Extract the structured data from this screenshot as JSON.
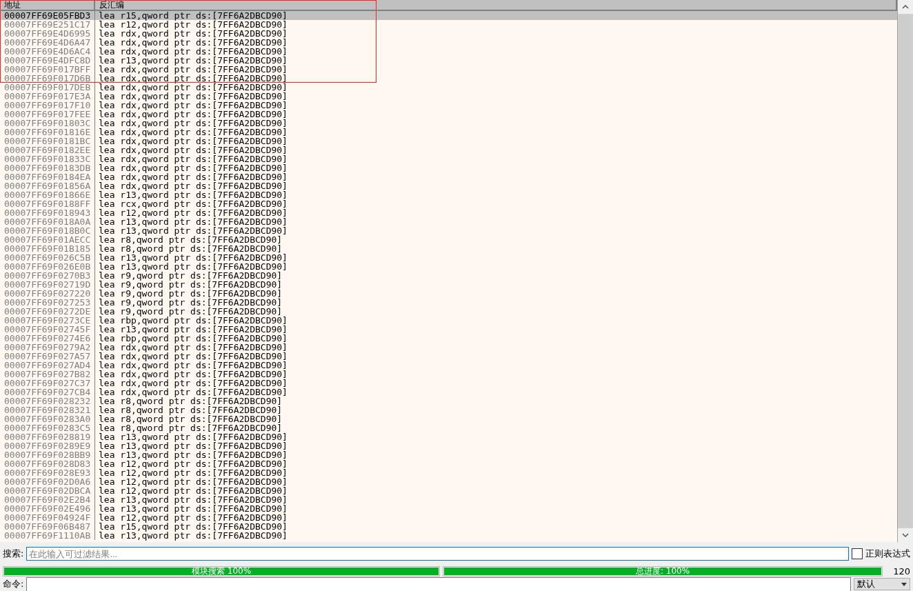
{
  "table": {
    "columns": [
      "地址",
      "反汇编"
    ],
    "rows": [
      {
        "address": "00007FF69E05FBD3",
        "disassembly": "lea r15,qword ptr ds:[7FF6A2DBCD90]",
        "selected": true,
        "boxed": true
      },
      {
        "address": "00007FF69E251C17",
        "disassembly": "lea r12,qword ptr ds:[7FF6A2DBCD90]",
        "selected": false,
        "boxed": true
      },
      {
        "address": "00007FF69E4D6995",
        "disassembly": "lea rdx,qword ptr ds:[7FF6A2DBCD90]",
        "selected": false,
        "boxed": true
      },
      {
        "address": "00007FF69E4D6A47",
        "disassembly": "lea rdx,qword ptr ds:[7FF6A2DBCD90]",
        "selected": false,
        "boxed": true
      },
      {
        "address": "00007FF69E4D6AC4",
        "disassembly": "lea rdx,qword ptr ds:[7FF6A2DBCD90]",
        "selected": false,
        "boxed": true
      },
      {
        "address": "00007FF69E4DFC8D",
        "disassembly": "lea r13,qword ptr ds:[7FF6A2DBCD90]",
        "selected": false,
        "boxed": true
      },
      {
        "address": "00007FF69F017BFF",
        "disassembly": "lea rdx,qword ptr ds:[7FF6A2DBCD90]",
        "selected": false,
        "boxed": true
      },
      {
        "address": "00007FF69F017D6B",
        "disassembly": "lea rdx,qword ptr ds:[7FF6A2DBCD90]",
        "selected": false,
        "boxed": true
      },
      {
        "address": "00007FF69F017DEB",
        "disassembly": "lea rdx,qword ptr ds:[7FF6A2DBCD90]",
        "selected": false,
        "boxed": false
      },
      {
        "address": "00007FF69F017E3A",
        "disassembly": "lea rdx,qword ptr ds:[7FF6A2DBCD90]",
        "selected": false,
        "boxed": false
      },
      {
        "address": "00007FF69F017F10",
        "disassembly": "lea rdx,qword ptr ds:[7FF6A2DBCD90]",
        "selected": false,
        "boxed": false
      },
      {
        "address": "00007FF69F017FEE",
        "disassembly": "lea rdx,qword ptr ds:[7FF6A2DBCD90]",
        "selected": false,
        "boxed": false
      },
      {
        "address": "00007FF69F01803C",
        "disassembly": "lea rdx,qword ptr ds:[7FF6A2DBCD90]",
        "selected": false,
        "boxed": false
      },
      {
        "address": "00007FF69F01816E",
        "disassembly": "lea rdx,qword ptr ds:[7FF6A2DBCD90]",
        "selected": false,
        "boxed": false
      },
      {
        "address": "00007FF69F0181BC",
        "disassembly": "lea rdx,qword ptr ds:[7FF6A2DBCD90]",
        "selected": false,
        "boxed": false
      },
      {
        "address": "00007FF69F0182EE",
        "disassembly": "lea rdx,qword ptr ds:[7FF6A2DBCD90]",
        "selected": false,
        "boxed": false
      },
      {
        "address": "00007FF69F01833C",
        "disassembly": "lea rdx,qword ptr ds:[7FF6A2DBCD90]",
        "selected": false,
        "boxed": false
      },
      {
        "address": "00007FF69F0183DB",
        "disassembly": "lea rdx,qword ptr ds:[7FF6A2DBCD90]",
        "selected": false,
        "boxed": false
      },
      {
        "address": "00007FF69F0184EA",
        "disassembly": "lea rdx,qword ptr ds:[7FF6A2DBCD90]",
        "selected": false,
        "boxed": false
      },
      {
        "address": "00007FF69F01856A",
        "disassembly": "lea rdx,qword ptr ds:[7FF6A2DBCD90]",
        "selected": false,
        "boxed": false
      },
      {
        "address": "00007FF69F01866E",
        "disassembly": "lea r13,qword ptr ds:[7FF6A2DBCD90]",
        "selected": false,
        "boxed": false
      },
      {
        "address": "00007FF69F0188FF",
        "disassembly": "lea rcx,qword ptr ds:[7FF6A2DBCD90]",
        "selected": false,
        "boxed": false
      },
      {
        "address": "00007FF69F018943",
        "disassembly": "lea r12,qword ptr ds:[7FF6A2DBCD90]",
        "selected": false,
        "boxed": false
      },
      {
        "address": "00007FF69F018A0A",
        "disassembly": "lea r13,qword ptr ds:[7FF6A2DBCD90]",
        "selected": false,
        "boxed": false
      },
      {
        "address": "00007FF69F018B0C",
        "disassembly": "lea r13,qword ptr ds:[7FF6A2DBCD90]",
        "selected": false,
        "boxed": false
      },
      {
        "address": "00007FF69F01AECC",
        "disassembly": "lea r8,qword ptr ds:[7FF6A2DBCD90]",
        "selected": false,
        "boxed": false
      },
      {
        "address": "00007FF69F01B185",
        "disassembly": "lea r8,qword ptr ds:[7FF6A2DBCD90]",
        "selected": false,
        "boxed": false
      },
      {
        "address": "00007FF69F026C5B",
        "disassembly": "lea r13,qword ptr ds:[7FF6A2DBCD90]",
        "selected": false,
        "boxed": false
      },
      {
        "address": "00007FF69F026E0B",
        "disassembly": "lea r13,qword ptr ds:[7FF6A2DBCD90]",
        "selected": false,
        "boxed": false
      },
      {
        "address": "00007FF69F0270B3",
        "disassembly": "lea r9,qword ptr ds:[7FF6A2DBCD90]",
        "selected": false,
        "boxed": false
      },
      {
        "address": "00007FF69F02719D",
        "disassembly": "lea r9,qword ptr ds:[7FF6A2DBCD90]",
        "selected": false,
        "boxed": false
      },
      {
        "address": "00007FF69F027220",
        "disassembly": "lea r9,qword ptr ds:[7FF6A2DBCD90]",
        "selected": false,
        "boxed": false
      },
      {
        "address": "00007FF69F027253",
        "disassembly": "lea r9,qword ptr ds:[7FF6A2DBCD90]",
        "selected": false,
        "boxed": false
      },
      {
        "address": "00007FF69F0272DE",
        "disassembly": "lea r9,qword ptr ds:[7FF6A2DBCD90]",
        "selected": false,
        "boxed": false
      },
      {
        "address": "00007FF69F0273CE",
        "disassembly": "lea rbp,qword ptr ds:[7FF6A2DBCD90]",
        "selected": false,
        "boxed": false
      },
      {
        "address": "00007FF69F02745F",
        "disassembly": "lea r13,qword ptr ds:[7FF6A2DBCD90]",
        "selected": false,
        "boxed": false
      },
      {
        "address": "00007FF69F0274E6",
        "disassembly": "lea rbp,qword ptr ds:[7FF6A2DBCD90]",
        "selected": false,
        "boxed": false
      },
      {
        "address": "00007FF69F0279A2",
        "disassembly": "lea rdx,qword ptr ds:[7FF6A2DBCD90]",
        "selected": false,
        "boxed": false
      },
      {
        "address": "00007FF69F027A57",
        "disassembly": "lea rdx,qword ptr ds:[7FF6A2DBCD90]",
        "selected": false,
        "boxed": false
      },
      {
        "address": "00007FF69F027AD4",
        "disassembly": "lea rdx,qword ptr ds:[7FF6A2DBCD90]",
        "selected": false,
        "boxed": false
      },
      {
        "address": "00007FF69F027B82",
        "disassembly": "lea rdx,qword ptr ds:[7FF6A2DBCD90]",
        "selected": false,
        "boxed": false
      },
      {
        "address": "00007FF69F027C37",
        "disassembly": "lea rdx,qword ptr ds:[7FF6A2DBCD90]",
        "selected": false,
        "boxed": false
      },
      {
        "address": "00007FF69F027CB4",
        "disassembly": "lea rdx,qword ptr ds:[7FF6A2DBCD90]",
        "selected": false,
        "boxed": false
      },
      {
        "address": "00007FF69F028232",
        "disassembly": "lea r8,qword ptr ds:[7FF6A2DBCD90]",
        "selected": false,
        "boxed": false
      },
      {
        "address": "00007FF69F028321",
        "disassembly": "lea r8,qword ptr ds:[7FF6A2DBCD90]",
        "selected": false,
        "boxed": false
      },
      {
        "address": "00007FF69F0283A0",
        "disassembly": "lea r8,qword ptr ds:[7FF6A2DBCD90]",
        "selected": false,
        "boxed": false
      },
      {
        "address": "00007FF69F0283C5",
        "disassembly": "lea r8,qword ptr ds:[7FF6A2DBCD90]",
        "selected": false,
        "boxed": false
      },
      {
        "address": "00007FF69F028819",
        "disassembly": "lea r13,qword ptr ds:[7FF6A2DBCD90]",
        "selected": false,
        "boxed": false
      },
      {
        "address": "00007FF69F0289E9",
        "disassembly": "lea r13,qword ptr ds:[7FF6A2DBCD90]",
        "selected": false,
        "boxed": false
      },
      {
        "address": "00007FF69F028BB9",
        "disassembly": "lea r13,qword ptr ds:[7FF6A2DBCD90]",
        "selected": false,
        "boxed": false
      },
      {
        "address": "00007FF69F028D83",
        "disassembly": "lea r12,qword ptr ds:[7FF6A2DBCD90]",
        "selected": false,
        "boxed": false
      },
      {
        "address": "00007FF69F028E93",
        "disassembly": "lea r12,qword ptr ds:[7FF6A2DBCD90]",
        "selected": false,
        "boxed": false
      },
      {
        "address": "00007FF69F02D0A6",
        "disassembly": "lea r12,qword ptr ds:[7FF6A2DBCD90]",
        "selected": false,
        "boxed": false
      },
      {
        "address": "00007FF69F02DBCA",
        "disassembly": "lea r12,qword ptr ds:[7FF6A2DBCD90]",
        "selected": false,
        "boxed": false
      },
      {
        "address": "00007FF69F02E2B4",
        "disassembly": "lea r13,qword ptr ds:[7FF6A2DBCD90]",
        "selected": false,
        "boxed": false
      },
      {
        "address": "00007FF69F02E496",
        "disassembly": "lea r13,qword ptr ds:[7FF6A2DBCD90]",
        "selected": false,
        "boxed": false
      },
      {
        "address": "00007FF69F04924F",
        "disassembly": "lea r12,qword ptr ds:[7FF6A2DBCD90]",
        "selected": false,
        "boxed": false
      },
      {
        "address": "00007FF69F06B487",
        "disassembly": "lea r15,qword ptr ds:[7FF6A2DBCD90]",
        "selected": false,
        "boxed": false
      },
      {
        "address": "00007FF69F1110AB",
        "disassembly": "lea r13,qword ptr ds:[7FF6A2DBCD90]",
        "selected": false,
        "boxed": false
      }
    ]
  },
  "search": {
    "label": "搜索:",
    "placeholder": "在此输入可过滤结果...",
    "regex": {
      "label": "正则表达式",
      "checked": false
    }
  },
  "progress": [
    {
      "label": "模块搜索 100%",
      "level": 1
    },
    {
      "label": "总进度: 100%",
      "level": 1
    }
  ],
  "count": "120",
  "command": {
    "label": "命令:",
    "mode": "默认"
  }
}
